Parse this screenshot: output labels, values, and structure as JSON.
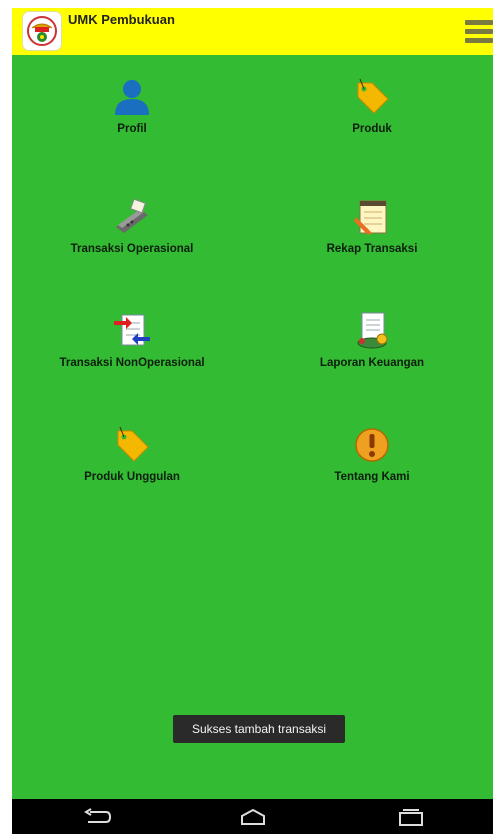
{
  "app": {
    "title": "UMK Pembukuan",
    "logo_icon": "umk-logo"
  },
  "header": {
    "menu_icon": "hamburger-menu-icon",
    "background": "#ffff00"
  },
  "content": {
    "background": "#33bb33"
  },
  "menu": [
    {
      "label": "Profil",
      "icon": "person-icon"
    },
    {
      "label": "Produk",
      "icon": "tag-icon"
    },
    {
      "label": "Transaksi Operasional",
      "icon": "card-terminal-icon"
    },
    {
      "label": "Rekap Transaksi",
      "icon": "notepad-pencil-icon"
    },
    {
      "label": "Transaksi NonOperasional",
      "icon": "transfer-document-icon"
    },
    {
      "label": "Laporan Keuangan",
      "icon": "report-money-icon"
    },
    {
      "label": "Produk Unggulan",
      "icon": "tag-icon"
    },
    {
      "label": "Tentang Kami",
      "icon": "info-exclamation-icon"
    }
  ],
  "toast": {
    "message": "Sukses tambah transaksi"
  },
  "navbar": {
    "back": "back-icon",
    "home": "home-icon",
    "recents": "recents-icon"
  }
}
